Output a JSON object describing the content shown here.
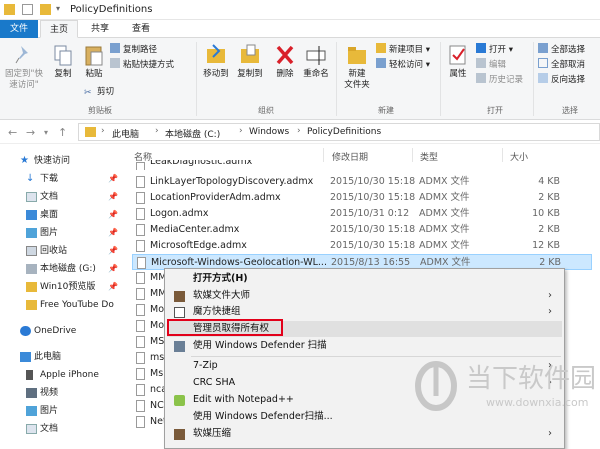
{
  "window": {
    "title": "PolicyDefinitions"
  },
  "tabs": {
    "file": "文件",
    "home": "主页",
    "share": "共享",
    "view": "查看"
  },
  "ribbon": {
    "pin": "固定到\"快\n速访问\"",
    "copy": "复制",
    "paste": "粘贴",
    "copy_path": "复制路径",
    "paste_shortcut": "粘贴快捷方式",
    "cut": "剪切",
    "clipboard": "剪贴板",
    "move_to": "移动到",
    "copy_to": "复制到",
    "delete": "删除",
    "rename": "重命名",
    "organize": "组织",
    "new_folder": "新建\n文件夹",
    "new_item": "新建项目 ▾",
    "easy_access": "轻松访问 ▾",
    "new": "新建",
    "properties": "属性",
    "open": "打开 ▾",
    "edit": "编辑",
    "history": "历史记录",
    "open_group": "打开",
    "select_all": "全部选择",
    "select_none": "全部取消",
    "invert": "反向选择",
    "select": "选择"
  },
  "address": {
    "crumbs": [
      "此电脑",
      "本地磁盘 (C:)",
      "Windows",
      "PolicyDefinitions"
    ]
  },
  "nav": {
    "items": [
      "快速访问",
      "下载",
      "文档",
      "桌面",
      "图片",
      "回收站",
      "本地磁盘 (G:)",
      "Win10预览版",
      "Free YouTube Do",
      "OneDrive",
      "此电脑",
      "Apple iPhone",
      "视频",
      "图片",
      "文档"
    ]
  },
  "columns": {
    "name": "名称",
    "date": "修改日期",
    "type": "类型",
    "size": "大小"
  },
  "files": [
    {
      "name": "LeakDiagnostic.admx",
      "date": "",
      "type": "",
      "size": ""
    },
    {
      "name": "LinkLayerTopologyDiscovery.admx",
      "date": "2015/10/30 15:18",
      "type": "ADMX 文件",
      "size": "4 KB"
    },
    {
      "name": "LocationProviderAdm.admx",
      "date": "2015/10/30 15:18",
      "type": "ADMX 文件",
      "size": "2 KB"
    },
    {
      "name": "Logon.admx",
      "date": "2015/10/31 0:12",
      "type": "ADMX 文件",
      "size": "10 KB"
    },
    {
      "name": "MediaCenter.admx",
      "date": "2015/10/30 15:18",
      "type": "ADMX 文件",
      "size": "2 KB"
    },
    {
      "name": "MicrosoftEdge.admx",
      "date": "2015/10/30 15:18",
      "type": "ADMX 文件",
      "size": "12 KB"
    },
    {
      "name": "Microsoft-Windows-Geolocation-WL...",
      "date": "2015/8/13 16:55",
      "type": "ADMX 文件",
      "size": "2 KB"
    },
    {
      "name": "MM",
      "date": "",
      "type": "",
      "size": ""
    },
    {
      "name": "MM",
      "date": "",
      "type": "",
      "size": ""
    },
    {
      "name": "Mo",
      "date": "",
      "type": "",
      "size": ""
    },
    {
      "name": "Mo",
      "date": "",
      "type": "",
      "size": ""
    },
    {
      "name": "MS",
      "date": "",
      "type": "",
      "size": ""
    },
    {
      "name": "msi",
      "date": "",
      "type": "",
      "size": ""
    },
    {
      "name": "Msi",
      "date": "",
      "type": "",
      "size": ""
    },
    {
      "name": "nca",
      "date": "",
      "type": "",
      "size": ""
    },
    {
      "name": "NC",
      "date": "",
      "type": "",
      "size": ""
    },
    {
      "name": "Net",
      "date": "",
      "type": "",
      "size": ""
    }
  ],
  "menu": {
    "items": [
      {
        "label": "打开方式(H)"
      },
      {
        "label": "软媒文件大师"
      },
      {
        "label": "魔方快捷组"
      },
      {
        "label": "管理员取得所有权"
      },
      {
        "label": "使用 Windows Defender 扫描"
      },
      {
        "label": "7-Zip"
      },
      {
        "label": "CRC SHA"
      },
      {
        "label": "Edit with Notepad++"
      },
      {
        "label": "使用 Windows Defender扫描..."
      },
      {
        "label": "软媒压缩"
      }
    ]
  },
  "watermark": {
    "title": "当下软件园",
    "url": "www.downxia.com"
  }
}
